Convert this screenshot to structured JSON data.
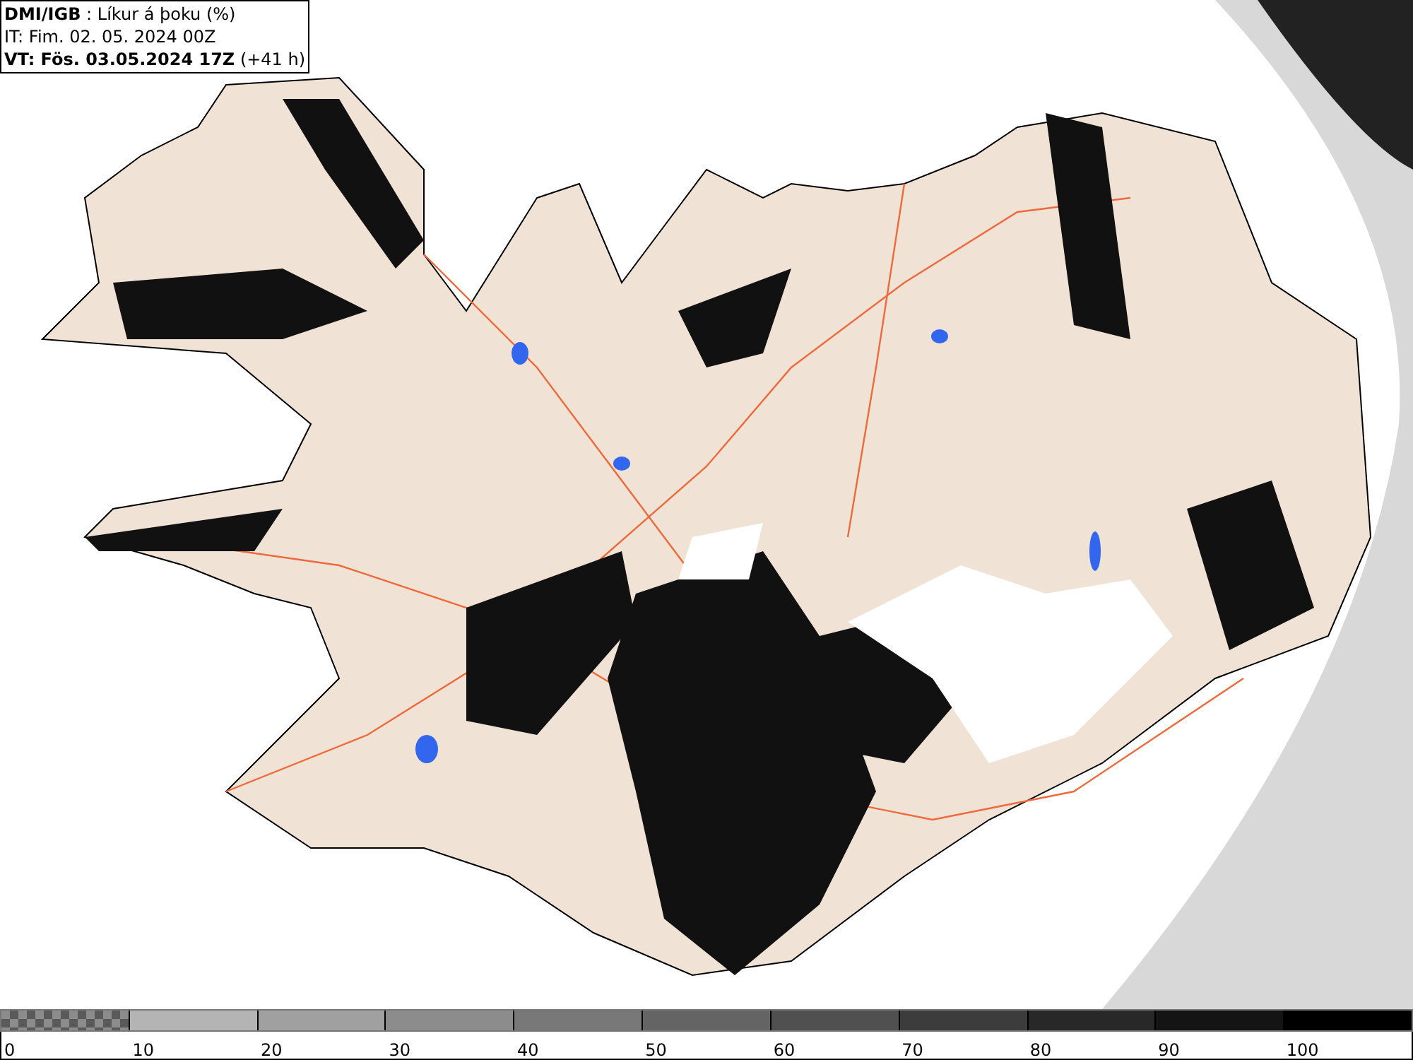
{
  "header": {
    "lines": [
      "**DMI/IGB** : Líkur á þoku (%)",
      "IT: Fim. 02. 05. 2024 00Z",
      "**VT: Fös. 03.05.2024 17Z** (+41 h)"
    ]
  },
  "legend": {
    "bins": [
      {
        "kind": "pattern",
        "color": "#8c8c8c",
        "label": "0"
      },
      {
        "kind": "solid",
        "color": "#b4b4b4",
        "label": "10"
      },
      {
        "kind": "solid",
        "color": "#a0a0a0",
        "label": "20"
      },
      {
        "kind": "solid",
        "color": "#8c8c8c",
        "label": "30"
      },
      {
        "kind": "solid",
        "color": "#787878",
        "label": "40"
      },
      {
        "kind": "solid",
        "color": "#646464",
        "label": "50"
      },
      {
        "kind": "solid",
        "color": "#505050",
        "label": "60"
      },
      {
        "kind": "solid",
        "color": "#3c3c3c",
        "label": "70"
      },
      {
        "kind": "solid",
        "color": "#282828",
        "label": "80"
      },
      {
        "kind": "solid",
        "color": "#141414",
        "label": "90"
      },
      {
        "kind": "solid",
        "color": "#000000",
        "label": "100"
      }
    ]
  }
}
